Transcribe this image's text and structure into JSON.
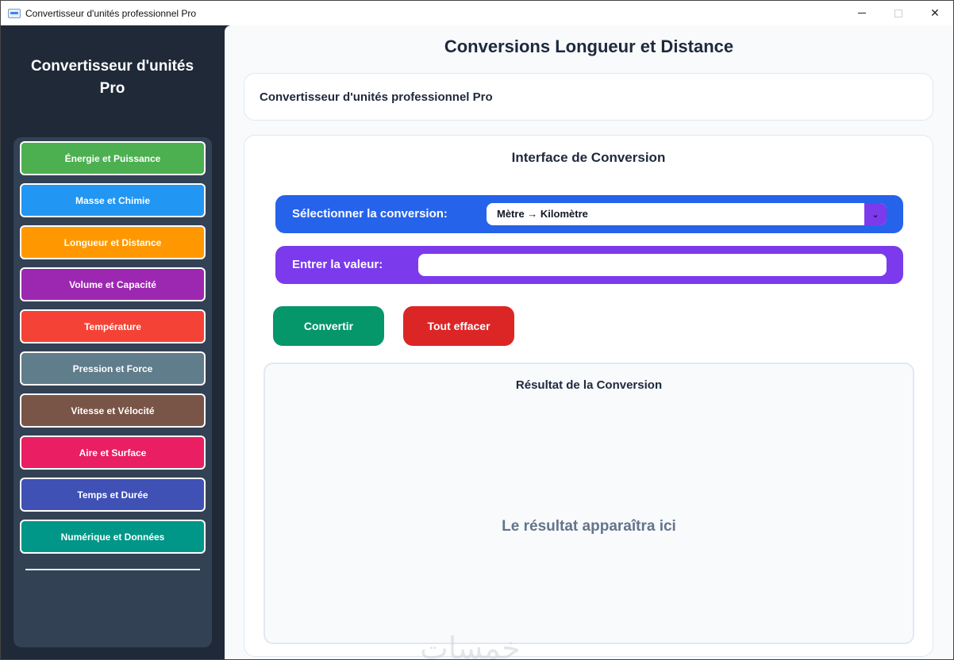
{
  "window": {
    "title": "Convertisseur d'unités professionnel Pro",
    "controls": {
      "minimize": "—",
      "maximize": "☐",
      "close": "✕"
    }
  },
  "sidebar": {
    "title_line1": "Convertisseur d'unités",
    "title_line2": "Pro",
    "categories": [
      {
        "label": "Énergie et Puissance",
        "color": "#4caf50"
      },
      {
        "label": "Masse et Chimie",
        "color": "#2196f3"
      },
      {
        "label": "Longueur et Distance",
        "color": "#ff9800"
      },
      {
        "label": "Volume et Capacité",
        "color": "#9c27b0"
      },
      {
        "label": "Température",
        "color": "#f44336"
      },
      {
        "label": "Pression et Force",
        "color": "#607d8b"
      },
      {
        "label": "Vitesse et Vélocité",
        "color": "#795548"
      },
      {
        "label": "Aire et Surface",
        "color": "#e91e63"
      },
      {
        "label": "Temps et Durée",
        "color": "#3f51b5"
      },
      {
        "label": "Numérique et Données",
        "color": "#009688"
      }
    ]
  },
  "main": {
    "page_title": "Conversions Longueur et Distance",
    "info_card_text": "Convertisseur d'unités professionnel Pro",
    "interface_title": "Interface de Conversion",
    "select_label": "Sélectionner la conversion:",
    "select_value": "Mètre → Kilomètre",
    "value_label": "Entrer la valeur:",
    "value_input": "",
    "convert_button": "Convertir",
    "clear_button": "Tout effacer",
    "result_title": "Résultat de la Conversion",
    "result_placeholder": "Le résultat apparaîtra ici"
  },
  "watermark": "خمسات"
}
